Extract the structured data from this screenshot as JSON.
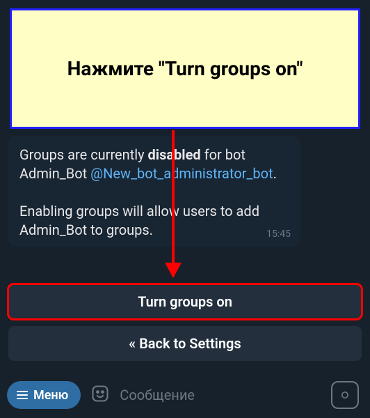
{
  "callout": {
    "text": "Нажмите \"Turn groups on\""
  },
  "message": {
    "line1_prefix": "Groups are currently ",
    "line1_bold": "disabled",
    "line1_suffix": " for bot Admin_Bot ",
    "bot_link": "@New_bot_administrator_bot",
    "line1_end": ".",
    "line2": "Enabling groups will allow users to add Admin_Bot to groups.",
    "time": "15:45"
  },
  "buttons": {
    "turn_on": "Turn groups on",
    "back": "« Back to Settings"
  },
  "input_bar": {
    "menu_label": "Меню",
    "placeholder": "Сообщение"
  }
}
